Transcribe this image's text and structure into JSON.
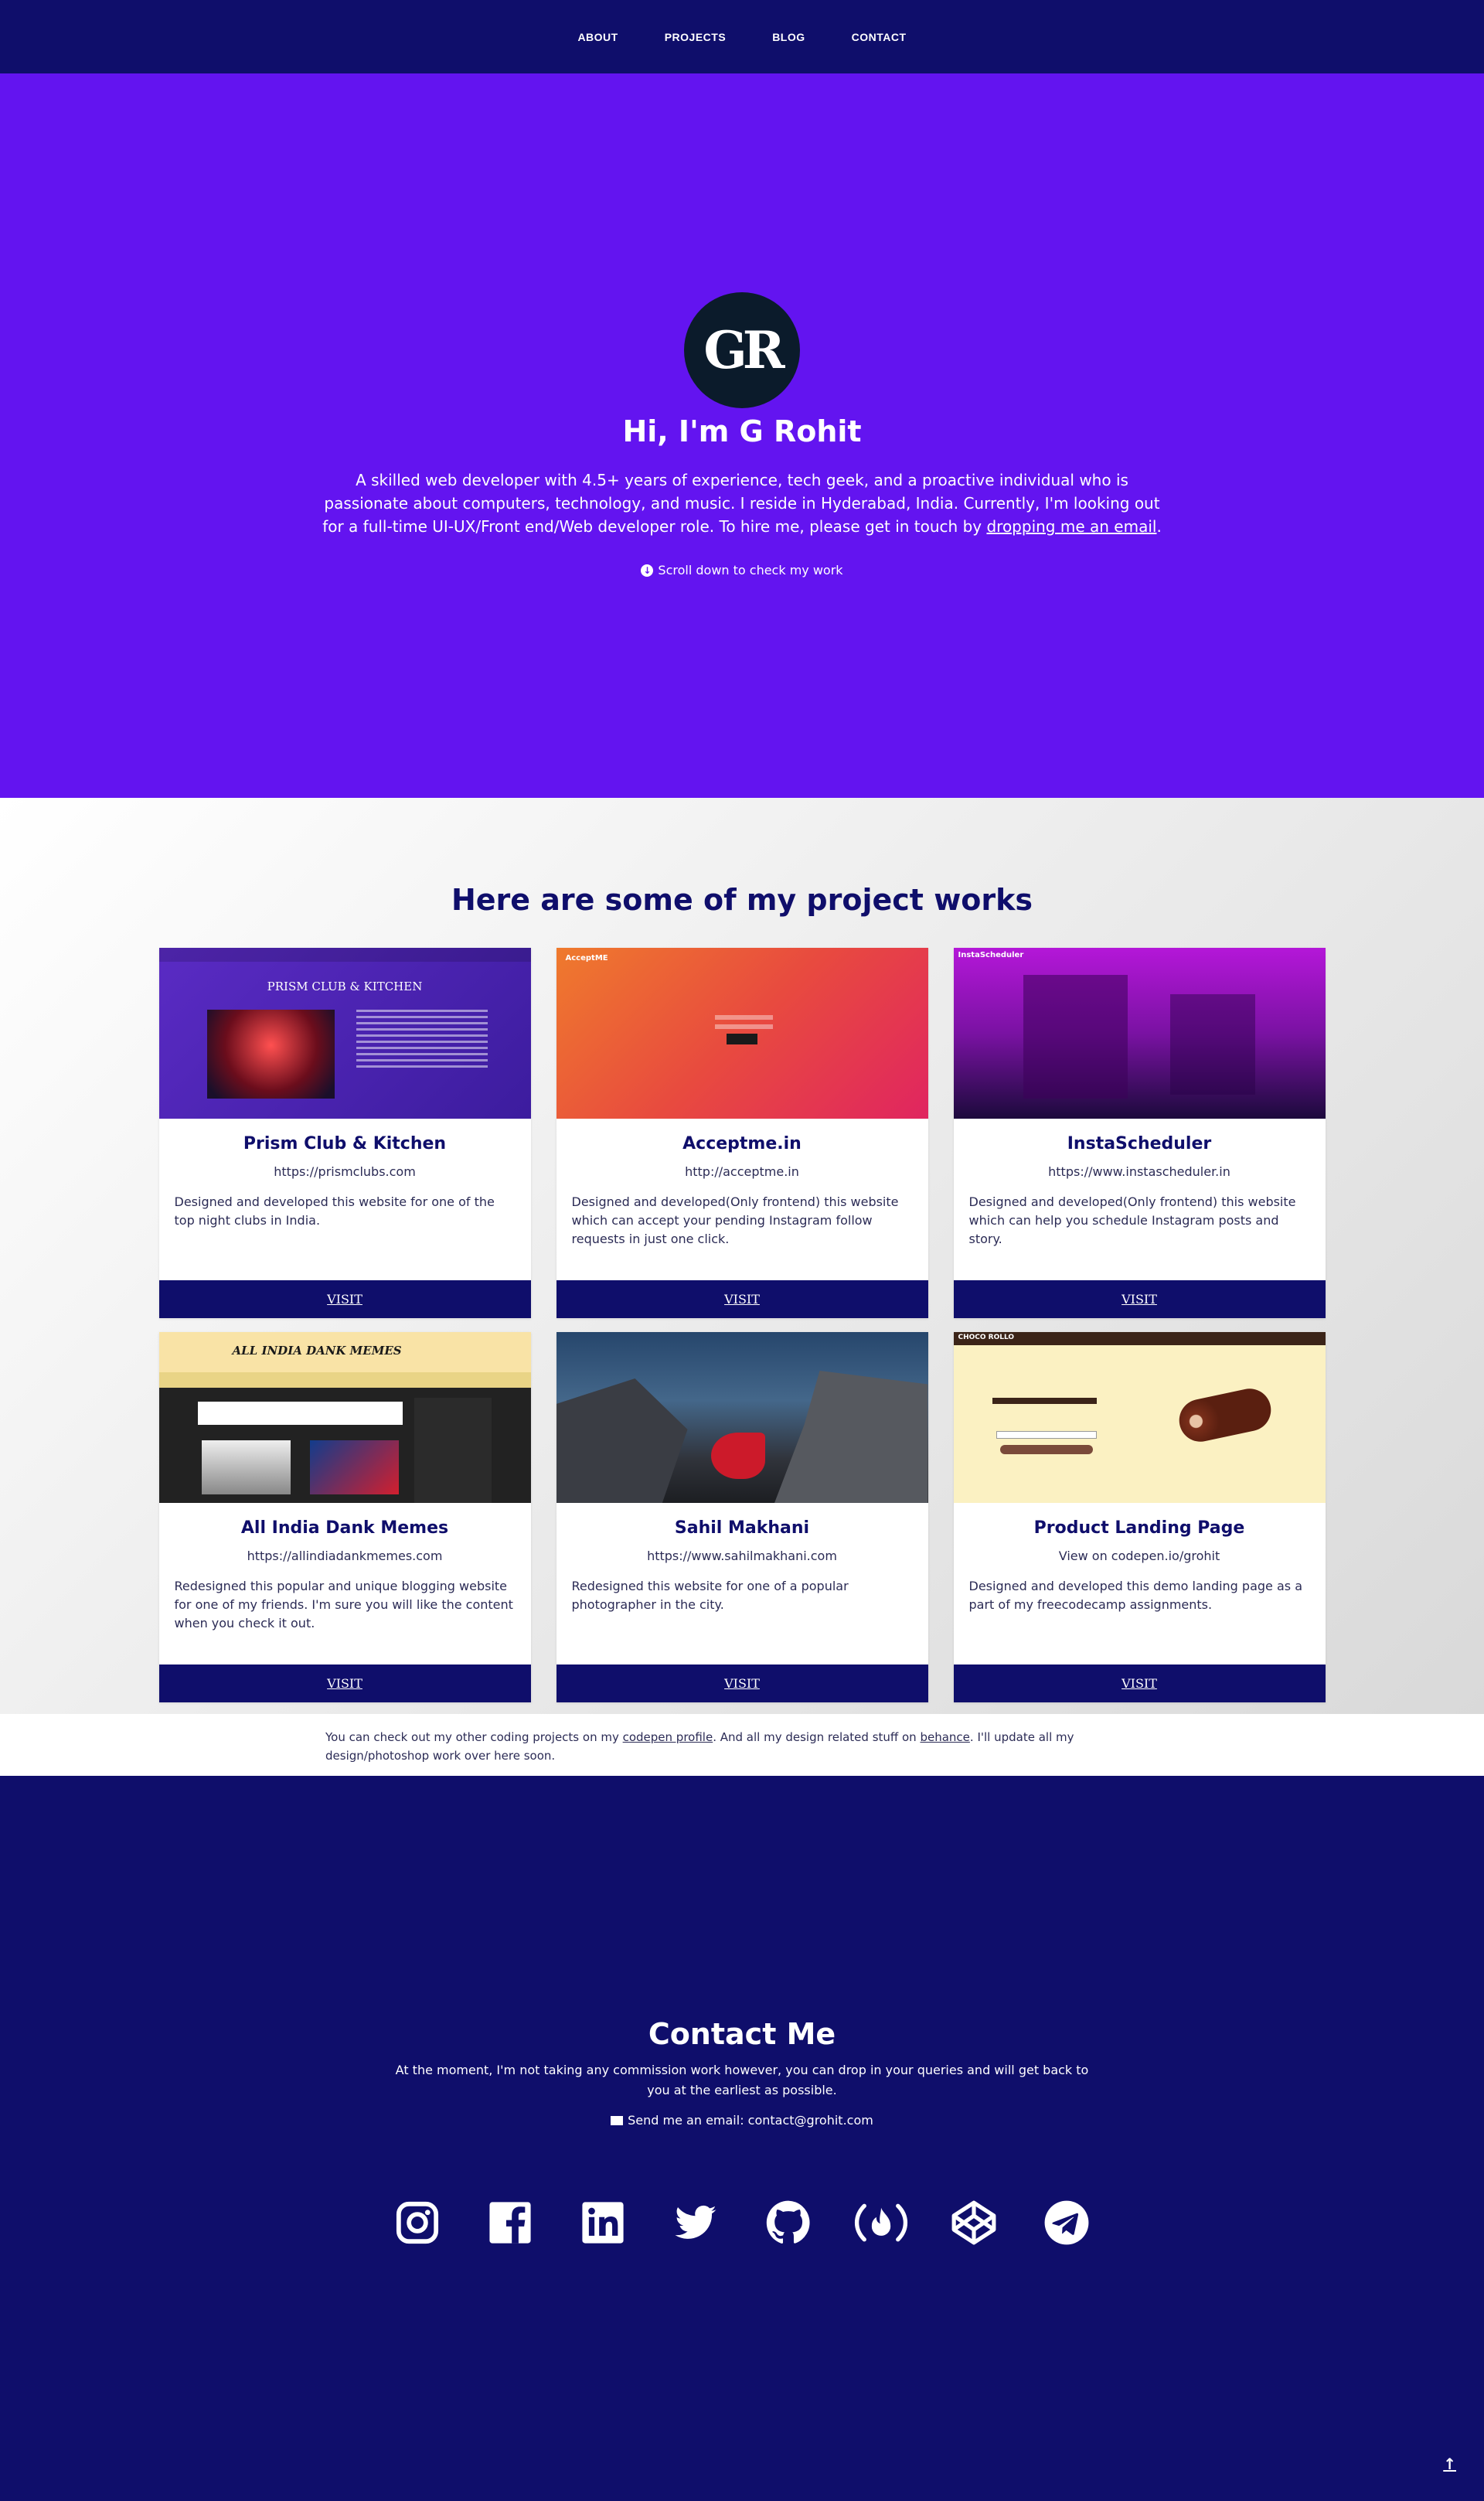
{
  "nav": {
    "items": [
      "ABOUT",
      "PROJECTS",
      "BLOG",
      "CONTACT"
    ]
  },
  "hero": {
    "logo_text": "GR",
    "heading": "Hi, I'm G Rohit",
    "bio_before": "A skilled web developer with 4.5+ years of experience, tech geek, and a proactive individual who is passionate about computers, technology, and music. I reside in Hyderabad, India. Currently, I'm looking out for a full-time UI-UX/Front end/Web developer role. To hire me, please get in touch by ",
    "bio_link": "dropping me an email",
    "bio_after": ".",
    "scroll_text": "Scroll down to check my work"
  },
  "projects": {
    "heading": "Here are some of my project works",
    "cards": [
      {
        "title": "Prism Club & Kitchen",
        "url": "https://prismclubs.com",
        "desc": "Designed and developed this website for one of the top night clubs in India.",
        "visit": "VISIT",
        "thumb_text": "PRISM CLUB & KITCHEN"
      },
      {
        "title": "Acceptme.in",
        "url": "http://acceptme.in",
        "desc": "Designed and developed(Only frontend) this website which can accept your pending Instagram follow requests in just one click.",
        "visit": "VISIT",
        "thumb_text": "AcceptME"
      },
      {
        "title": "InstaScheduler",
        "url": "https://www.instascheduler.in",
        "desc": "Designed and developed(Only frontend) this website which can help you schedule Instagram posts and story.",
        "visit": "VISIT",
        "thumb_text": "InstaScheduler"
      },
      {
        "title": "All India Dank Memes",
        "url": "https://allindiadankmemes.com",
        "desc": "Redesigned this popular and unique blogging website for one of my friends. I'm sure you will like the content when you check it out.",
        "visit": "VISIT",
        "thumb_text": "ALL INDIA DANK MEMES"
      },
      {
        "title": "Sahil Makhani",
        "url": "https://www.sahilmakhani.com",
        "desc": "Redesigned this website for one of a popular photographer in the city.",
        "visit": "VISIT",
        "thumb_text": ""
      },
      {
        "title": "Product Landing Page",
        "url": "View on codepen.io/grohit",
        "desc": "Designed and developed this demo landing page as a part of my freecodecamp assignments.",
        "visit": "VISIT",
        "thumb_text": "CHOCO ROLLO"
      }
    ]
  },
  "note": {
    "text1": "You can check out my other coding projects on my ",
    "link1": "codepen profile",
    "text2": ". And all my design related stuff on ",
    "link2": "behance",
    "text3": ". I'll update all my design/photoshop work over here soon."
  },
  "contact": {
    "heading": "Contact Me",
    "sub": "At the moment, I'm not taking any commission work however, you can drop in your queries and will get back to you at the earliest as possible.",
    "email_text": "Send me an email: contact@grohit.com",
    "socials": [
      "instagram-icon",
      "facebook-icon",
      "linkedin-icon",
      "twitter-icon",
      "github-icon",
      "freecodecamp-icon",
      "codepen-icon",
      "telegram-icon"
    ],
    "scroll_top": "↑"
  },
  "colors": {
    "nav_bg": "#0f0e6b",
    "hero_bg": "#6314f0",
    "accent": "#0f0e6b"
  }
}
